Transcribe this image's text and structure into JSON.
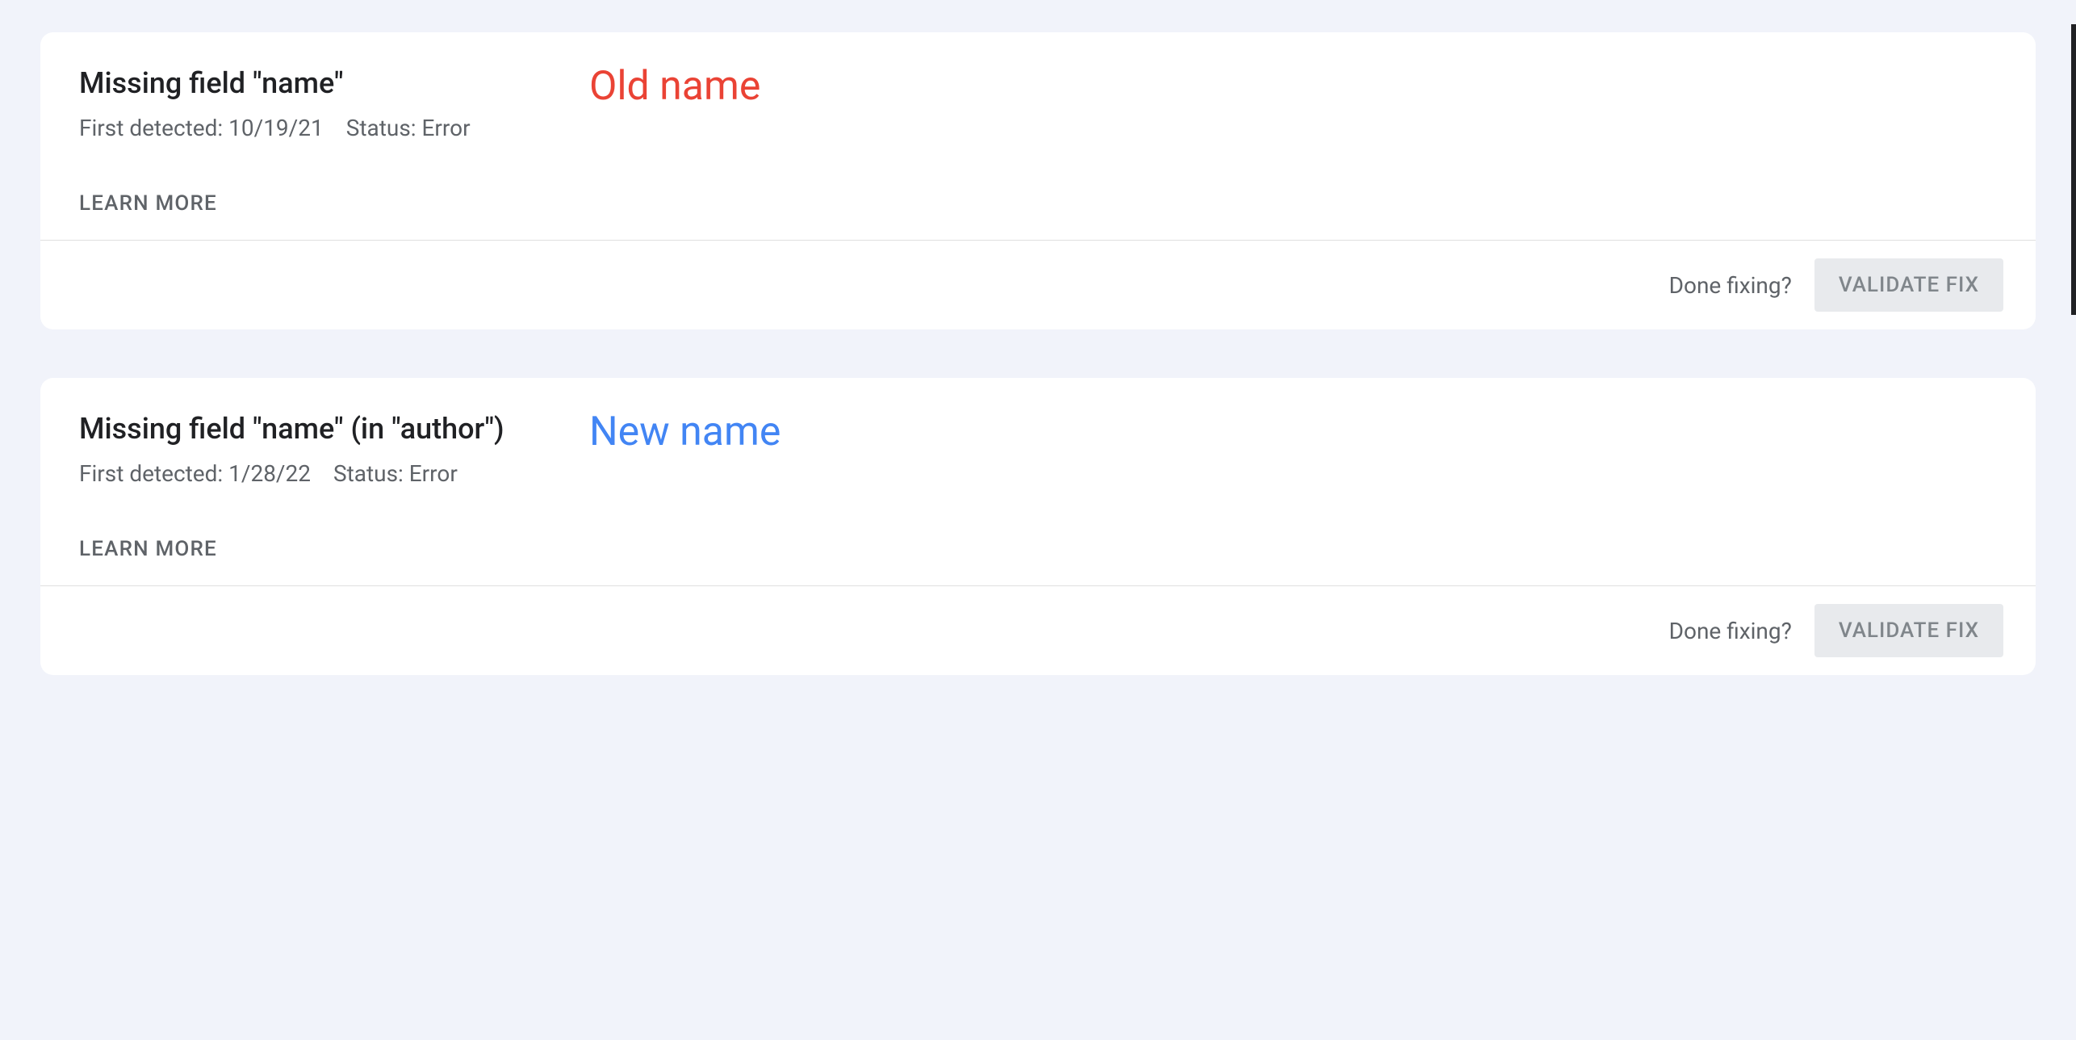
{
  "cards": [
    {
      "title": "Missing field \"name\"",
      "first_detected_label": "First detected:",
      "first_detected_value": "10/19/21",
      "status_label": "Status:",
      "status_value": "Error",
      "learn_more": "LEARN MORE",
      "done_fixing": "Done fixing?",
      "validate_fix": "VALIDATE FIX",
      "annotation": "Old name",
      "annotation_class": "annotation-old"
    },
    {
      "title": "Missing field \"name\" (in \"author\")",
      "first_detected_label": "First detected:",
      "first_detected_value": "1/28/22",
      "status_label": "Status:",
      "status_value": "Error",
      "learn_more": "LEARN MORE",
      "done_fixing": "Done fixing?",
      "validate_fix": "VALIDATE FIX",
      "annotation": "New name",
      "annotation_class": "annotation-new"
    }
  ]
}
